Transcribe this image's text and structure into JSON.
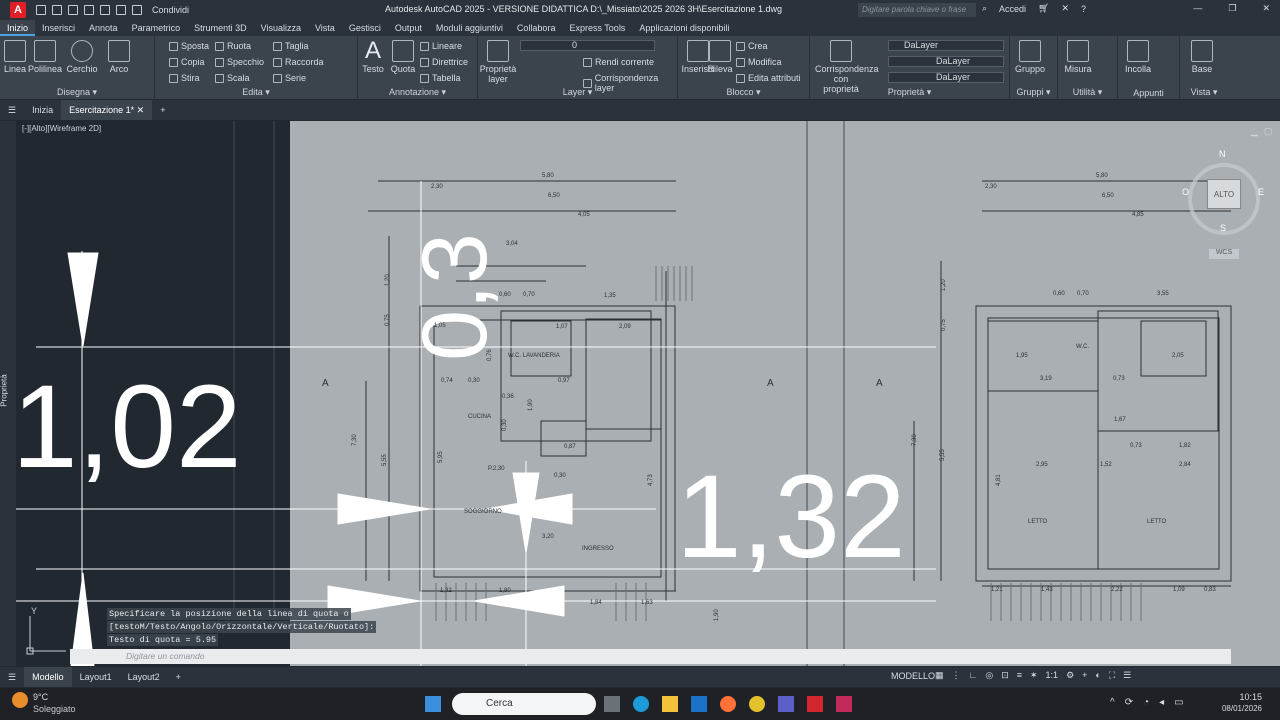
{
  "titlebar": {
    "logo": "A",
    "share": "Condividi",
    "title": "Autodesk AutoCAD 2025 - VERSIONE DIDATTICA   D:\\_Missiato\\2025 2026 3H\\Esercitazione 1.dwg",
    "search_placeholder": "Digitare parola chiave o frase",
    "login": "Accedi"
  },
  "tabs": [
    "Inizio",
    "Inserisci",
    "Annota",
    "Parametrico",
    "Strumenti 3D",
    "Visualizza",
    "Vista",
    "Gestisci",
    "Output",
    "Moduli aggiuntivi",
    "Collabora",
    "Express Tools",
    "Applicazioni disponibili"
  ],
  "ribbon": {
    "disegna": {
      "label": "Disegna ▾",
      "tools": [
        "Linea",
        "Polilinea",
        "Cerchio",
        "Arco"
      ]
    },
    "edita": {
      "label": "Edita ▾",
      "tools": [
        "Sposta",
        "Ruota",
        "Taglia",
        "Copia",
        "Specchio",
        "Raccorda",
        "Stira",
        "Scala",
        "Serie"
      ]
    },
    "annotazione": {
      "label": "Annotazione ▾",
      "big": [
        "Testo",
        "Quota"
      ],
      "tools": [
        "Lineare",
        "Direttrice",
        "Tabella"
      ]
    },
    "layer": {
      "label": "Layer ▾",
      "big": "Proprietà layer",
      "current": "0",
      "tools": [
        "Rendi corrente",
        "Corrispondenza layer"
      ]
    },
    "blocco": {
      "label": "Blocco ▾",
      "big": [
        "Inserisci",
        "Rileva"
      ],
      "tools": [
        "Crea",
        "Modifica",
        "Edita attributi"
      ]
    },
    "proprieta": {
      "label": "Proprietà ▾",
      "big": "Corrispondenza con proprietà",
      "dropdowns": [
        "DaLayer",
        "DaLayer",
        "DaLayer"
      ]
    },
    "gruppi": {
      "label": "Gruppi ▾",
      "big": "Gruppo"
    },
    "utilita": {
      "label": "Utilità ▾",
      "big": "Misura"
    },
    "appunti": {
      "label": "Appunti",
      "big": "Incolla"
    },
    "vista": {
      "label": "Vista ▾",
      "big": "Base"
    }
  },
  "doctabs": [
    "Inizia",
    "Esercitazione 1*"
  ],
  "viewport_label": "[-][Alto][Wireframe 2D]",
  "viewcube": {
    "n": "N",
    "s": "S",
    "e": "E",
    "w": "O",
    "face": "ALTO",
    "wcs": "WCS"
  },
  "drawing": {
    "overlay_dims": [
      "1,02",
      "0,3",
      "1,32"
    ],
    "dims_left": [
      "2,30",
      "5,80",
      "6,50",
      "4,05",
      "3,04",
      "1,20",
      "0,75",
      "0,60",
      "0,70",
      "1,35",
      "1,05",
      "1,07",
      "2,09",
      "0,30",
      "0,74",
      "0,76",
      "0,97",
      "1,90",
      "0,36",
      "0,30",
      "0,87",
      "7,30",
      "5,55",
      "5,95",
      "4,73",
      "0,30",
      "3,20",
      "1,32",
      "1,80",
      "1,84",
      "1,63",
      "1,90"
    ],
    "dims_right": [
      "2,30",
      "5,80",
      "6,50",
      "4,85",
      "1,20",
      "0,75",
      "0,60",
      "0,70",
      "3,55",
      "1,95",
      "3,19",
      "0,73",
      "2,05",
      "1,67",
      "0,73",
      "1,82",
      "2,95",
      "2,84",
      "1,52",
      "7,30",
      "5,55",
      "4,81",
      "1,21",
      "1,43",
      "2,22",
      "1,09",
      "0,83"
    ],
    "rooms_left": [
      "W.C. LAVANDERIA",
      "CUCINA",
      "SOGGIORNO",
      "INGRESSO",
      "P.2,30"
    ],
    "rooms_right": [
      "W.C.",
      "LETTO",
      "LETTO"
    ],
    "section_marks": [
      "A",
      "A",
      "A"
    ]
  },
  "cmdlog": [
    "Specificare la posizione della linea di quota o",
    "[testoM/Testo/Angolo/Orizzontale/Verticale/Ruotato]:",
    "Testo di quota = 5.95"
  ],
  "cmd_placeholder": "Digitare un comando",
  "status": {
    "tabs": [
      "Modello",
      "Layout1",
      "Layout2"
    ],
    "mode": "MODELLO",
    "scale": "1:1"
  },
  "taskbar": {
    "temp": "9°C",
    "weather": "Soleggiato",
    "search": "Cerca",
    "time": "10:15",
    "date": "08/01/2026"
  }
}
